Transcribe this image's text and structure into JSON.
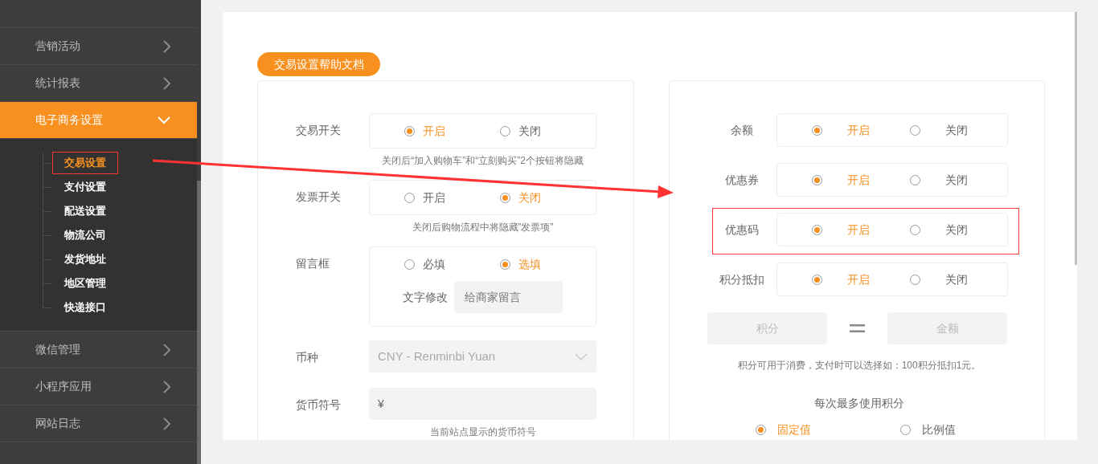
{
  "sidebar": {
    "items": [
      {
        "label": "营销活动",
        "expanded": false
      },
      {
        "label": "统计报表",
        "expanded": false
      },
      {
        "label": "电子商务设置",
        "expanded": true,
        "children": [
          {
            "label": "交易设置",
            "selected": true,
            "highlighted": true
          },
          {
            "label": "支付设置",
            "selected": false,
            "highlighted": false
          },
          {
            "label": "配送设置",
            "selected": false,
            "highlighted": false
          },
          {
            "label": "物流公司",
            "selected": false,
            "highlighted": false
          },
          {
            "label": "发货地址",
            "selected": false,
            "highlighted": false
          },
          {
            "label": "地区管理",
            "selected": false,
            "highlighted": false
          },
          {
            "label": "快递接口",
            "selected": false,
            "highlighted": false
          }
        ]
      },
      {
        "label": "微信管理",
        "expanded": false
      },
      {
        "label": "小程序应用",
        "expanded": false
      },
      {
        "label": "网站日志",
        "expanded": false
      }
    ]
  },
  "help_button": "交易设置帮助文档",
  "left_panel": {
    "rows": [
      {
        "kind": "toggle",
        "label": "交易开关",
        "options": [
          {
            "label": "开启",
            "selected": true
          },
          {
            "label": "关闭",
            "selected": false
          }
        ],
        "hint": "关闭后“加入购物车”和“立刻购买”2个按钮将隐藏"
      },
      {
        "kind": "toggle",
        "label": "发票开关",
        "options": [
          {
            "label": "开启",
            "selected": false
          },
          {
            "label": "关闭",
            "selected": true
          }
        ],
        "hint": "关闭后购物流程中将隐藏”发票项”"
      },
      {
        "kind": "toggle_text",
        "label": "留言框",
        "options": [
          {
            "label": "必填",
            "selected": false
          },
          {
            "label": "选填",
            "selected": true
          }
        ],
        "sub_label": "文字修改",
        "value": "给商家留言"
      },
      {
        "kind": "select",
        "label": "币种",
        "value": "CNY - Renminbi Yuan"
      },
      {
        "kind": "input",
        "label": "货币符号",
        "value": "¥",
        "hint": "当前站点显示的货币符号"
      }
    ]
  },
  "right_panel": {
    "rows": [
      {
        "label": "余额",
        "highlighted": false,
        "options": [
          {
            "label": "开启",
            "selected": true
          },
          {
            "label": "关闭",
            "selected": false
          }
        ]
      },
      {
        "label": "优惠券",
        "highlighted": false,
        "options": [
          {
            "label": "开启",
            "selected": true
          },
          {
            "label": "关闭",
            "selected": false
          }
        ]
      },
      {
        "label": "优惠码",
        "highlighted": true,
        "options": [
          {
            "label": "开启",
            "selected": true
          },
          {
            "label": "关闭",
            "selected": false
          }
        ]
      },
      {
        "label": "积分抵扣",
        "highlighted": false,
        "options": [
          {
            "label": "开启",
            "selected": true
          },
          {
            "label": "关闭",
            "selected": false
          }
        ]
      }
    ],
    "exchange": {
      "points_placeholder": "积分",
      "amount_placeholder": "金额"
    },
    "exchange_hint": "积分可用于消费，支付时可以选择如：100积分抵扣1元。",
    "max_points": {
      "title": "每次最多使用积分",
      "options": [
        {
          "label": "固定值",
          "selected": true
        },
        {
          "label": "比例值",
          "selected": false
        }
      ]
    }
  },
  "annotation_arrow": true
}
